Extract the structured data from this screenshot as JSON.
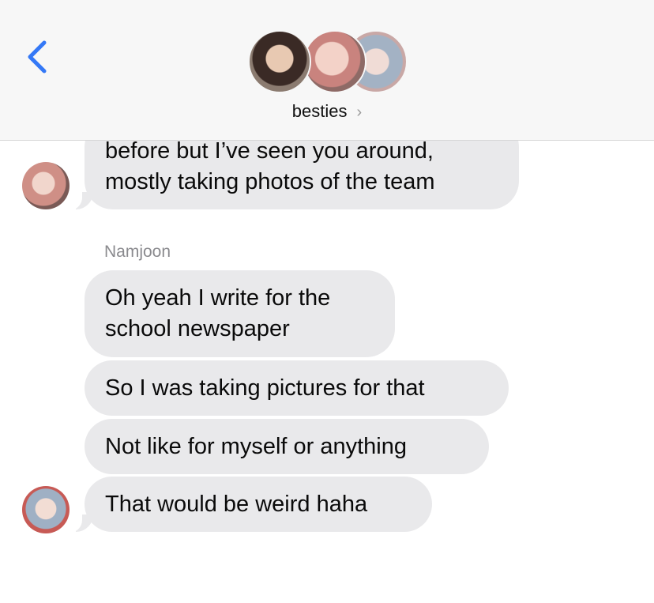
{
  "header": {
    "group_name": "besties",
    "chevron": "›",
    "back_icon": "chevron-left-icon",
    "accent_color": "#3478f6"
  },
  "messages": [
    {
      "sender": "",
      "text_lines": [
        "before but I’ve seen you around,",
        "mostly taking photos of the team"
      ]
    },
    {
      "sender": "Namjoon",
      "text_lines": [
        "Oh yeah I write for the",
        "school newspaper"
      ]
    },
    {
      "sender": "",
      "text_lines": [
        "So I was taking pictures for that"
      ]
    },
    {
      "sender": "",
      "text_lines": [
        "Not like for myself or anything"
      ]
    },
    {
      "sender": "",
      "text_lines": [
        "That would be weird haha"
      ]
    }
  ],
  "bubble_color": "#e9e9eb",
  "sender_label_color": "#8a8a8e"
}
